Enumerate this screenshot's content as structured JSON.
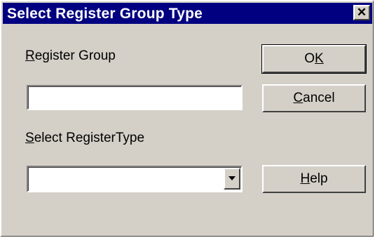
{
  "window": {
    "title": "Select Register Group Type",
    "close_glyph": "✕"
  },
  "register_group": {
    "label_mnemonic": "R",
    "label_rest": "egister Group",
    "value": ""
  },
  "register_type": {
    "label_mnemonic": "S",
    "label_rest": "elect RegisterType",
    "selected_value": ""
  },
  "buttons": {
    "ok_pre": "O",
    "ok_mnemonic": "K",
    "cancel_mnemonic": "C",
    "cancel_rest": "ancel",
    "help_mnemonic": "H",
    "help_rest": "elp"
  },
  "icons": {
    "close": "close-icon",
    "dropdown": "chevron-down-icon"
  },
  "colors": {
    "titlebar": "#000080",
    "face": "#d4d0c8"
  }
}
